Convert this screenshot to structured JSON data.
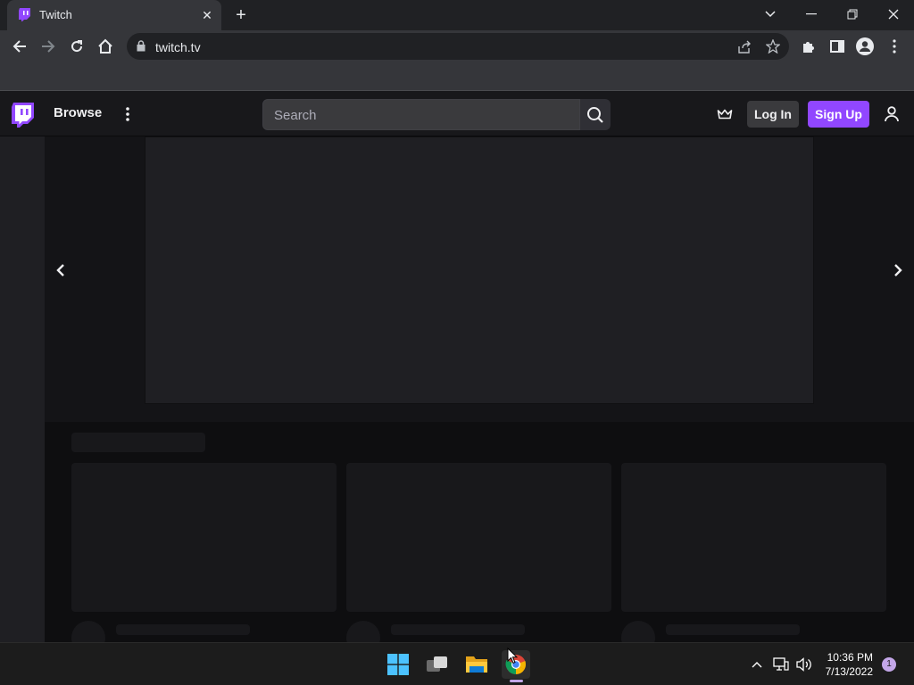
{
  "browser": {
    "tab_title": "Twitch",
    "url": "twitch.tv",
    "accent": "#9147ff"
  },
  "twitch": {
    "nav": {
      "browse_label": "Browse",
      "search_placeholder": "Search",
      "login_label": "Log In",
      "signup_label": "Sign Up"
    }
  },
  "taskbar": {
    "time": "10:36 PM",
    "date": "7/13/2022",
    "notification_count": "1"
  }
}
